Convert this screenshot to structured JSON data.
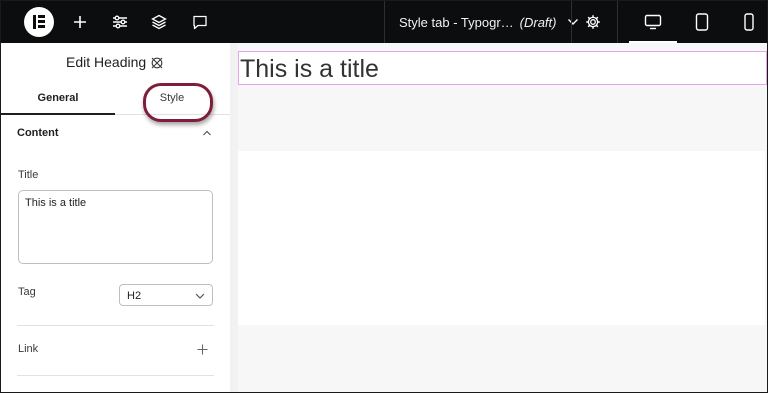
{
  "topbar": {
    "document_title": "Style tab - Typogr…",
    "document_status": "(Draft)",
    "icons": [
      "elementor-logo-icon",
      "plus-icon",
      "sliders-icon",
      "layers-icon",
      "comment-icon",
      "chevron-down-icon",
      "gear-icon",
      "desktop-icon",
      "tablet-icon",
      "mobile-icon"
    ],
    "active_device": "desktop"
  },
  "panel": {
    "title": "Edit Heading",
    "tabs": [
      "General",
      "Style"
    ],
    "active_tab": "General",
    "section_title": "Content",
    "title_label": "Title",
    "title_value": "This is a title",
    "tag_label": "Tag",
    "tag_value": "H2",
    "link_label": "Link"
  },
  "canvas": {
    "heading_text": "This is a title"
  },
  "colors": {
    "topbar_bg": "#0c0d0e",
    "highlight_ring": "#7d1f3a",
    "selection_outline": "#e5a6e8"
  }
}
